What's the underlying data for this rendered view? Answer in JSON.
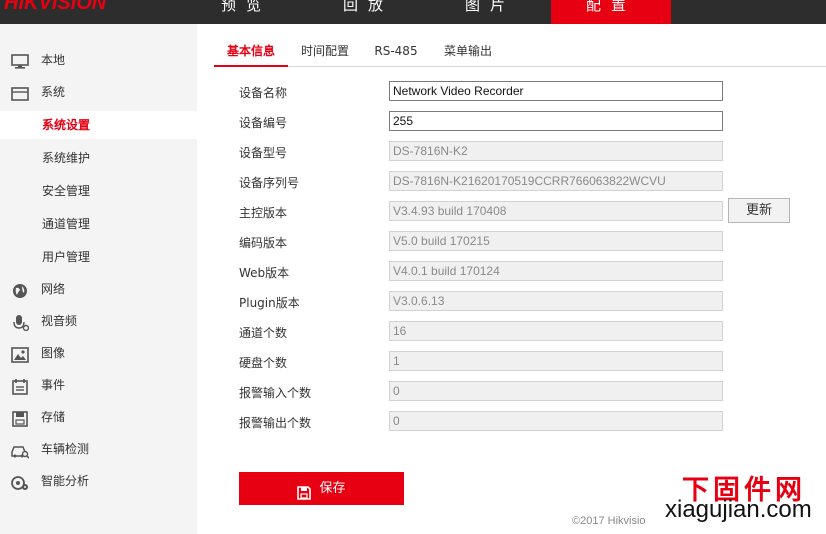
{
  "header": {
    "logo": "HIKVISION",
    "nav": [
      {
        "label": "预览"
      },
      {
        "label": "回放"
      },
      {
        "label": "图片"
      },
      {
        "label": "配置"
      }
    ],
    "active_nav": "配置",
    "accent_color": "#e60012"
  },
  "sidebar": {
    "items": [
      {
        "label": "本地",
        "icon": "monitor-icon"
      },
      {
        "label": "系统",
        "icon": "system-icon"
      },
      {
        "label": "系统设置"
      },
      {
        "label": "系统维护"
      },
      {
        "label": "安全管理"
      },
      {
        "label": "通道管理"
      },
      {
        "label": "用户管理"
      },
      {
        "label": "网络",
        "icon": "globe-icon"
      },
      {
        "label": "视音频",
        "icon": "microphone-icon"
      },
      {
        "label": "图像",
        "icon": "image-icon"
      },
      {
        "label": "事件",
        "icon": "calendar-icon"
      },
      {
        "label": "存储",
        "icon": "storage-icon"
      },
      {
        "label": "车辆检测",
        "icon": "vehicle-search-icon"
      },
      {
        "label": "智能分析",
        "icon": "smart-analysis-icon"
      }
    ],
    "active_item": "系统设置"
  },
  "tabs": [
    {
      "label": "基本信息"
    },
    {
      "label": "时间配置"
    },
    {
      "label": "RS-485"
    },
    {
      "label": "菜单输出"
    }
  ],
  "form": {
    "fields": [
      {
        "label": "设备名称",
        "value": "Network Video Recorder"
      },
      {
        "label": "设备编号",
        "value": "255"
      },
      {
        "label": "设备型号",
        "value": "DS-7816N-K2"
      },
      {
        "label": "设备序列号",
        "value": "DS-7816N-K21620170519CCRR766063822WCVU"
      },
      {
        "label": "主控版本",
        "value": "V3.4.93 build 170408"
      },
      {
        "label": "编码版本",
        "value": "V5.0 build 170215"
      },
      {
        "label": "Web版本",
        "value": "V4.0.1 build 170124"
      },
      {
        "label": "Plugin版本",
        "value": "V3.0.6.13"
      },
      {
        "label": "通道个数",
        "value": "16"
      },
      {
        "label": "硬盘个数",
        "value": "1"
      },
      {
        "label": "报警输入个数",
        "value": "0"
      },
      {
        "label": "报警输出个数",
        "value": "0"
      }
    ],
    "update_label": "更新",
    "save_label": "保存"
  },
  "footer": {
    "copyright": "©2017 Hikvisio"
  },
  "watermark": {
    "cn": "下固件网",
    "en": "xiagujian.com"
  }
}
